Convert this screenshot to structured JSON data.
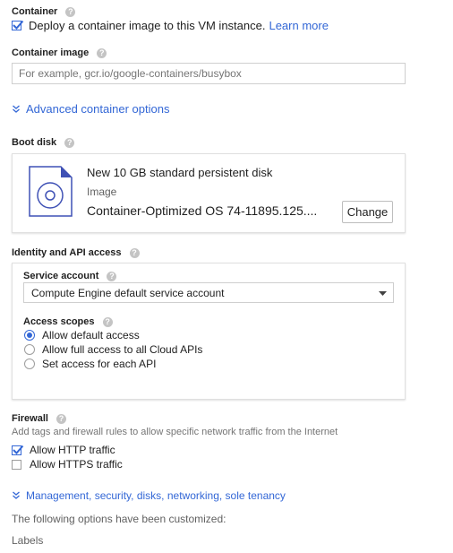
{
  "container": {
    "section_label": "Container",
    "deploy_checked": true,
    "deploy_label": "Deploy a container image to this VM instance.",
    "learn_more": "Learn more"
  },
  "container_image": {
    "label": "Container image",
    "placeholder": "For example, gcr.io/google-containers/busybox"
  },
  "advanced_container_options": "Advanced container options",
  "boot_disk": {
    "label": "Boot disk",
    "title": "New 10 GB standard persistent disk",
    "image_label": "Image",
    "image_value": "Container-Optimized OS 74-11895.125....",
    "change_button": "Change"
  },
  "identity": {
    "section_label": "Identity and API access",
    "service_account_label": "Service account",
    "service_account_value": "Compute Engine default service account",
    "access_scopes_label": "Access scopes",
    "scopes": [
      {
        "label": "Allow default access",
        "selected": true
      },
      {
        "label": "Allow full access to all Cloud APIs",
        "selected": false
      },
      {
        "label": "Set access for each API",
        "selected": false
      }
    ]
  },
  "firewall": {
    "label": "Firewall",
    "description": "Add tags and firewall rules to allow specific network traffic from the Internet",
    "options": [
      {
        "label": "Allow HTTP traffic",
        "checked": true
      },
      {
        "label": "Allow HTTPS traffic",
        "checked": false
      }
    ]
  },
  "management_link": "Management, security, disks, networking, sole tenancy",
  "customized_note": "The following options have been customized:",
  "labels_heading": "Labels",
  "help_glyph": "?",
  "colors": {
    "accent": "#3367d6",
    "help": "#c4c4c4",
    "border": "#e0e0e0"
  }
}
